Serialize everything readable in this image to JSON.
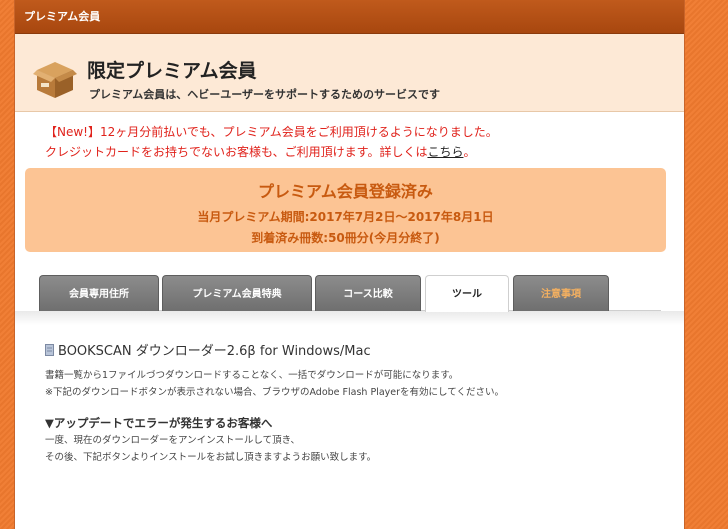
{
  "topbar": {
    "title": "プレミアム会員"
  },
  "header": {
    "title": "限定プレミアム会員",
    "subtitle": "プレミアム会員は、ヘビーユーザーをサポートするためのサービスです",
    "icon": "cardboard-box-icon"
  },
  "notice": {
    "line1": "【New!】12ヶ月分前払いでも、プレミアム会員をご利用頂けるようになりました。",
    "line2_prefix": "クレジットカードをお持ちでないお客様も、ご利用頂けます。詳しくは",
    "link_text": "こちら",
    "line2_suffix": "。"
  },
  "status": {
    "title": "プレミアム会員登録済み",
    "period": "当月プレミアム期間:2017年7月2日〜2017年8月1日",
    "books": "到着済み冊数:50冊分(今月分終了)"
  },
  "tabs": [
    {
      "label": "会員専用住所"
    },
    {
      "label": "プレミアム会員特典"
    },
    {
      "label": "コース比較"
    },
    {
      "label": "ツール",
      "active": true
    },
    {
      "label": "注意事項"
    }
  ],
  "content": {
    "download_title": "BOOKSCAN ダウンローダー2.6β for Windows/Mac",
    "desc1": "書籍一覧から1ファイルづつダウンロードすることなく、一括でダウンロードが可能になります。",
    "desc2": "※下記のダウンロードボタンが表示されない場合、ブラウザのAdobe Flash Playerを有効にしてください。",
    "update_heading": "▼アップデートでエラーが発生するお客様へ",
    "update1": "一度、現在のダウンローダーをアンインストールして頂き、",
    "update2": "その後、下記ボタンよりインストールをお試し頂きますようお願い致します。"
  },
  "colors": {
    "accent": "#f07a2e",
    "notice": "#e0221b",
    "status_bg": "#fcc494",
    "status_text": "#c85a10"
  }
}
